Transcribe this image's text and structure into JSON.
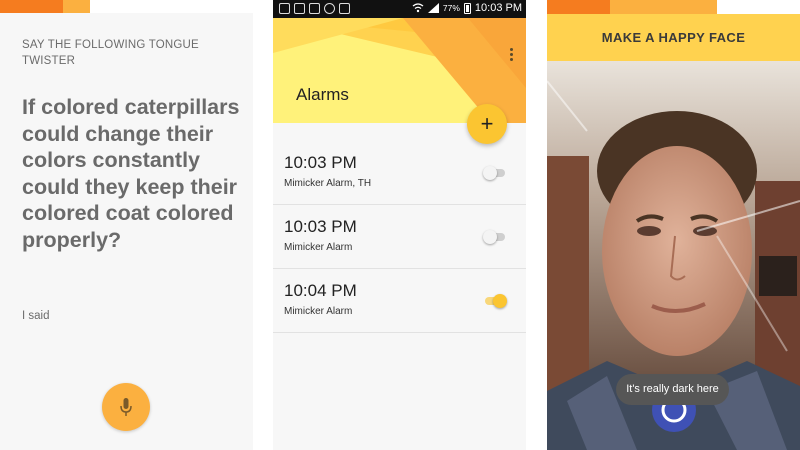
{
  "tongue_twister_screen": {
    "instruction": "SAY THE FOLLOWING TONGUE TWISTER",
    "twister": "If colored caterpillars could change their colors constantly could they keep their colored coat colored properly?",
    "said_label": "I said",
    "mic_icon": "microphone-icon"
  },
  "alarms_screen": {
    "status_bar": {
      "battery": "77%",
      "time": "10:03 PM"
    },
    "title": "Alarms",
    "add_button": "+",
    "menu_icon": "overflow-menu-icon",
    "alarms": [
      {
        "time": "10:03 PM",
        "label": "Mimicker Alarm, TH",
        "enabled": false
      },
      {
        "time": "10:03 PM",
        "label": "Mimicker Alarm",
        "enabled": false
      },
      {
        "time": "10:04 PM",
        "label": "Mimicker Alarm",
        "enabled": true
      }
    ]
  },
  "happy_face_screen": {
    "title": "MAKE A HAPPY FACE",
    "toast": "It's really dark here"
  },
  "colors": {
    "orange": "#f57c1f",
    "amber": "#fbb040",
    "yellow": "#fbc531",
    "spinner_blue": "#3f51b5"
  }
}
